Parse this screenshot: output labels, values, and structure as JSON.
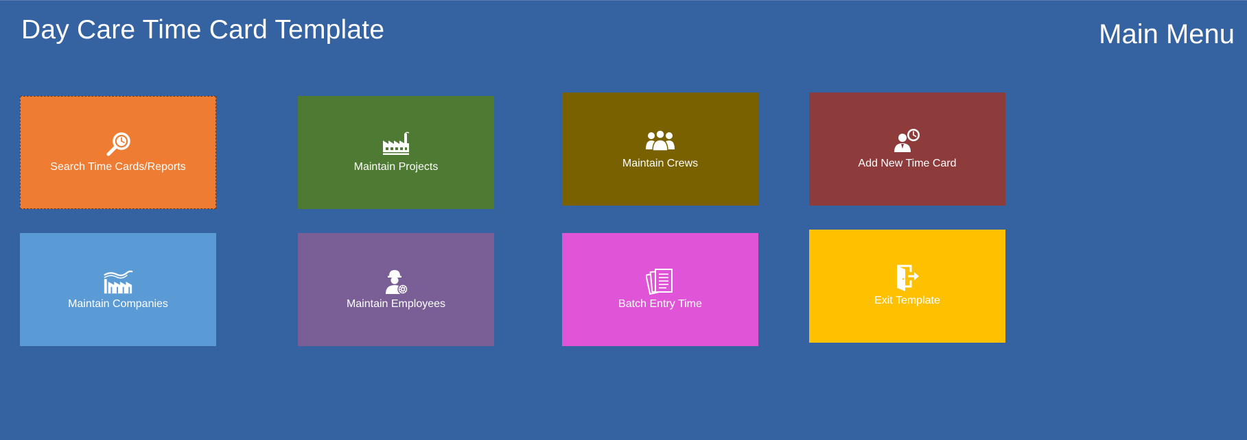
{
  "header": {
    "app_title": "Day Care Time Card Template",
    "menu_title": "Main Menu"
  },
  "colors": {
    "background": "#3562a0",
    "search": "#ee7d33",
    "projects": "#4e7a33",
    "crews": "#7a6100",
    "timecard": "#8e3b3b",
    "companies": "#5b9bd5",
    "employees": "#7a5f96",
    "batch": "#e055d8",
    "exit": "#ffc000"
  },
  "tiles": {
    "search": {
      "label": "Search Time Cards/Reports",
      "icon": "magnifier-clock-icon"
    },
    "projects": {
      "label": "Maintain Projects",
      "icon": "factory-icon"
    },
    "crews": {
      "label": "Maintain Crews",
      "icon": "people-group-icon"
    },
    "timecard": {
      "label": "Add New Time Card",
      "icon": "person-clock-icon"
    },
    "companies": {
      "label": "Maintain Companies",
      "icon": "industry-icon"
    },
    "employees": {
      "label": "Maintain Employees",
      "icon": "worker-gear-icon"
    },
    "batch": {
      "label": "Batch Entry Time",
      "icon": "documents-icon"
    },
    "exit": {
      "label": "Exit Template",
      "icon": "exit-door-icon"
    }
  }
}
